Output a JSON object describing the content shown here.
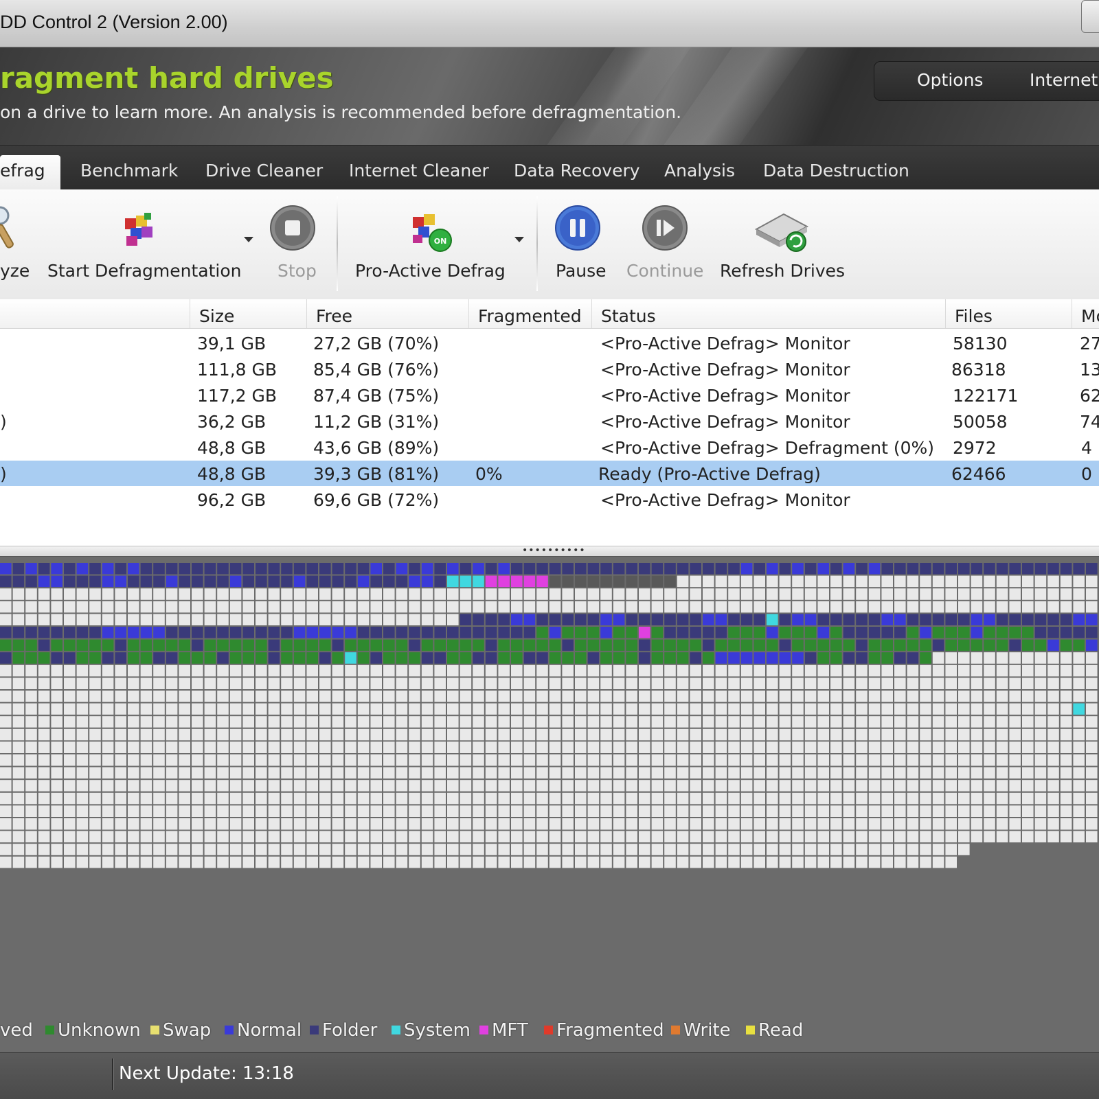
{
  "window": {
    "title": "DD Control 2 (Version 2.00)"
  },
  "header": {
    "title": "ragment hard drives",
    "subtitle": "on a drive to learn more. An analysis is recommended before defragmentation.",
    "nav": [
      "Options",
      "Internet"
    ]
  },
  "tabs": [
    "efrag",
    "Benchmark",
    "Drive Cleaner",
    "Internet Cleaner",
    "Data Recovery",
    "Analysis",
    "Data Destruction"
  ],
  "toolbar": {
    "analyze": "yze",
    "start": "Start Defragmentation",
    "stop": "Stop",
    "proactive": "Pro-Active Defrag",
    "pause": "Pause",
    "continue": "Continue",
    "refresh": "Refresh Drives"
  },
  "table": {
    "columns": [
      "Size",
      "Free",
      "Fragmented",
      "Status",
      "Files",
      "Mo"
    ],
    "rows": [
      {
        "name": "",
        "size": "39,1 GB",
        "free": "27,2 GB (70%)",
        "fragmented": "",
        "status": "<Pro-Active Defrag> Monitor",
        "files": "58130",
        "mo": "27"
      },
      {
        "name": "",
        "size": "111,8 GB",
        "free": "85,4 GB (76%)",
        "fragmented": "",
        "status": "<Pro-Active Defrag> Monitor",
        "files": "86318",
        "mo": "13"
      },
      {
        "name": "",
        "size": "117,2 GB",
        "free": "87,4 GB (75%)",
        "fragmented": "",
        "status": "<Pro-Active Defrag> Monitor",
        "files": "122171",
        "mo": "62"
      },
      {
        "name": ")",
        "size": "36,2 GB",
        "free": "11,2 GB (31%)",
        "fragmented": "",
        "status": "<Pro-Active Defrag> Monitor",
        "files": "50058",
        "mo": "74"
      },
      {
        "name": "",
        "size": "48,8 GB",
        "free": "43,6 GB (89%)",
        "fragmented": "",
        "status": "<Pro-Active Defrag> Defragment (0%)",
        "files": "2972",
        "mo": "4"
      },
      {
        "name": ")",
        "size": "48,8 GB",
        "free": "39,3 GB (81%)",
        "fragmented": "0%",
        "status": "Ready (Pro-Active Defrag)",
        "files": "62466",
        "mo": "0"
      },
      {
        "name": "",
        "size": "96,2 GB",
        "free": "69,6 GB (72%)",
        "fragmented": "",
        "status": "<Pro-Active Defrag> Monitor",
        "files": "",
        "mo": ""
      }
    ]
  },
  "legend": [
    {
      "label": "ved",
      "color": ""
    },
    {
      "label": "Unknown",
      "color": "#2f8a2f"
    },
    {
      "label": "Swap",
      "color": "#e8e070"
    },
    {
      "label": "Normal",
      "color": "#3a3ad8"
    },
    {
      "label": "Folder",
      "color": "#3a3a7a"
    },
    {
      "label": "System",
      "color": "#40d8e0"
    },
    {
      "label": "MFT",
      "color": "#e040e0"
    },
    {
      "label": "Fragmented",
      "color": "#e03a2a"
    },
    {
      "label": "Write",
      "color": "#e07a30"
    },
    {
      "label": "Read",
      "color": "#e8e040"
    }
  ],
  "statusbar": {
    "next_update": "Next Update: 13:18"
  }
}
